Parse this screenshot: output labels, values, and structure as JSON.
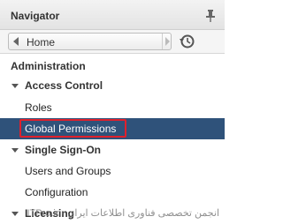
{
  "navigator": {
    "title": "Navigator",
    "home_label": "Home"
  },
  "tree": {
    "administration": "Administration",
    "access_control": "Access Control",
    "roles": "Roles",
    "global_permissions": "Global Permissions",
    "single_sign_on": "Single Sign-On",
    "users_and_groups": "Users and Groups",
    "configuration": "Configuration",
    "licensing": "Licensing"
  },
  "watermark": "ITPro.ir - انجمن تخصصی فناوری اطلاعات ایران",
  "colors": {
    "selected_bg": "#2f527a",
    "highlight_border": "#e0202c"
  }
}
